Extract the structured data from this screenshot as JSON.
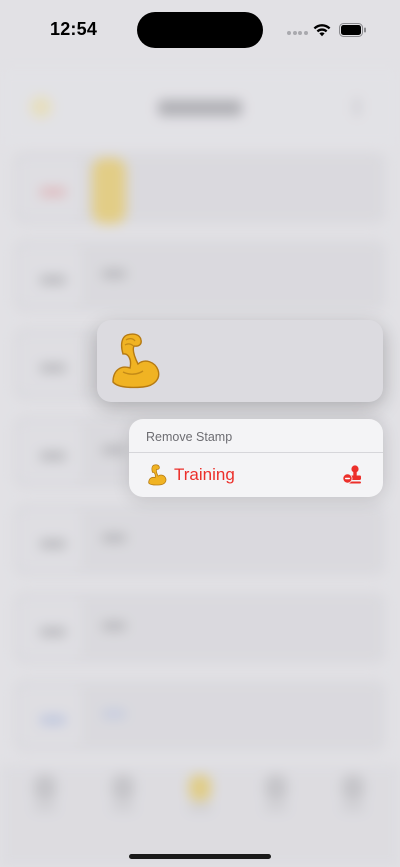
{
  "status_bar": {
    "time": "12:54",
    "icons": [
      "cellular-dots-icon",
      "wifi-icon",
      "battery-icon"
    ]
  },
  "focused_stamp": {
    "emoji_icon": "flexed-biceps-icon"
  },
  "context_menu": {
    "header": "Remove Stamp",
    "items": [
      {
        "label": "Training",
        "emoji_icon": "flexed-biceps-icon",
        "action_icon": "stamp-remove-icon",
        "color": "#ec2f2a"
      }
    ]
  },
  "colors": {
    "destructive": "#ec2f2a",
    "stamp_accent": "#f0b323"
  }
}
